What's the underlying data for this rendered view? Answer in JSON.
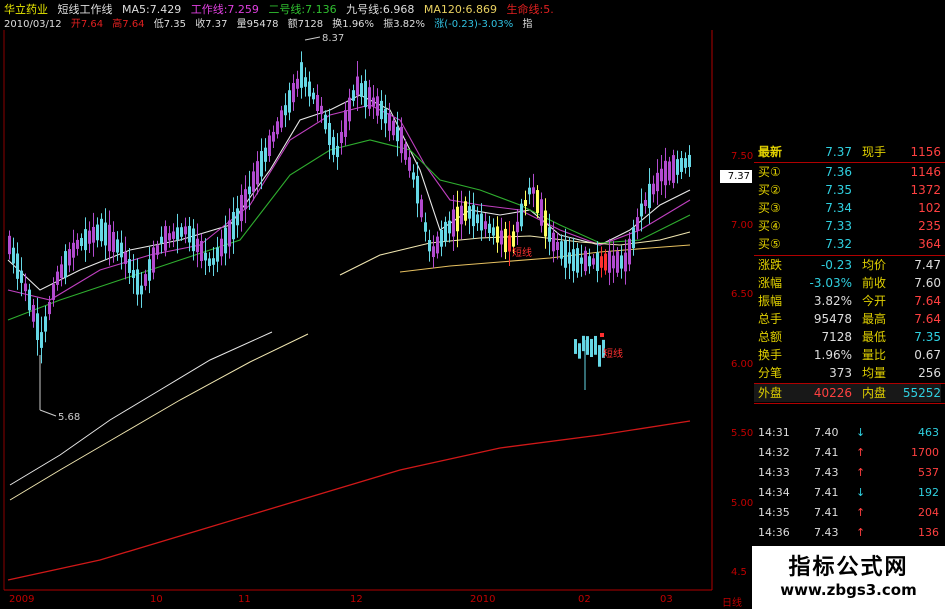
{
  "header": {
    "stock_name": "华立药业",
    "indicator_name": "短线工作线",
    "ma5": "MA5:7.429",
    "gong_zuo": "工作线:7.259",
    "er_hao": "二号线:7.136",
    "jiu_hao": "九号线:6.968",
    "ma120": "MA120:6.869",
    "sheng_ming": "生命线:5.",
    "date": "2010/03/12",
    "open": "开7.64",
    "high": "高7.64",
    "low": "低7.35",
    "close": "收7.37",
    "volume": "量95478",
    "amount": "额7128",
    "turnover": "换1.96%",
    "amplitude": "振3.82%",
    "change": "涨(-0.23)-3.03%",
    "tail": "指"
  },
  "chart_data": {
    "type": "candlestick",
    "title": "",
    "ylim": [
      4.5,
      7.7
    ],
    "yticks": [
      "7.50",
      "7.00",
      "6.50",
      "6.00",
      "5.50",
      "5.00",
      "4.5"
    ],
    "xticks": [
      "2009",
      "10",
      "11",
      "12",
      "2010",
      "02",
      "03"
    ],
    "x_axis_right_label": "日线",
    "annotations": {
      "high_label": "8.37",
      "low_label": "5.68",
      "signal_label_1": "短线",
      "signal_label_2": "短线"
    },
    "current_price_tag": "7.37",
    "colors": {
      "up": "#b34bd0",
      "down": "#66d8e6",
      "ma_white": "#e8e8e8",
      "ma_magenta": "#c040c0",
      "ma_green": "#2fae2f",
      "ma_cream": "#f0e6b0",
      "ma_yellow": "#e6c060",
      "life_line": "#d01818",
      "signal_yellow": "#ffff60",
      "signal_red": "#ff3030"
    }
  },
  "quote_panel": {
    "latest_label": "最新",
    "latest_value": "7.37",
    "now_hand_label": "现手",
    "now_hand_value": "1156",
    "bids": [
      {
        "label": "买①",
        "price": "7.36",
        "vol": "1146"
      },
      {
        "label": "买②",
        "price": "7.35",
        "vol": "1372"
      },
      {
        "label": "买③",
        "price": "7.34",
        "vol": "102"
      },
      {
        "label": "买④",
        "price": "7.33",
        "vol": "235"
      },
      {
        "label": "买⑤",
        "price": "7.32",
        "vol": "364"
      }
    ],
    "stats": [
      {
        "l1": "涨跌",
        "v1": "-0.23",
        "l2": "均价",
        "v2": "7.47"
      },
      {
        "l1": "涨幅",
        "v1": "-3.03%",
        "l2": "前收",
        "v2": "7.60"
      },
      {
        "l1": "振幅",
        "v1": "3.82%",
        "l2": "今开",
        "v2": "7.64"
      },
      {
        "l1": "总手",
        "v1": "95478",
        "l2": "最高",
        "v2": "7.64"
      },
      {
        "l1": "总额",
        "v1": "7128",
        "l2": "最低",
        "v2": "7.35"
      },
      {
        "l1": "换手",
        "v1": "1.96%",
        "l2": "量比",
        "v2": "0.67"
      },
      {
        "l1": "分笔",
        "v1": "373",
        "l2": "均量",
        "v2": "256"
      }
    ],
    "outer_label": "外盘",
    "outer_value": "40226",
    "inner_label": "内盘",
    "inner_value": "55252",
    "ticks": [
      {
        "time": "14:31",
        "price": "7.40",
        "dir": "↓",
        "vol": "463"
      },
      {
        "time": "14:32",
        "price": "7.41",
        "dir": "↑",
        "vol": "1700"
      },
      {
        "time": "14:33",
        "price": "7.43",
        "dir": "↑",
        "vol": "537"
      },
      {
        "time": "14:34",
        "price": "7.41",
        "dir": "↓",
        "vol": "192"
      },
      {
        "time": "14:35",
        "price": "7.41",
        "dir": "↑",
        "vol": "204"
      },
      {
        "time": "14:36",
        "price": "7.43",
        "dir": "↑",
        "vol": "136"
      }
    ]
  },
  "watermark": {
    "line1": "指标公式网",
    "line2": "www.zbgs3.com"
  }
}
